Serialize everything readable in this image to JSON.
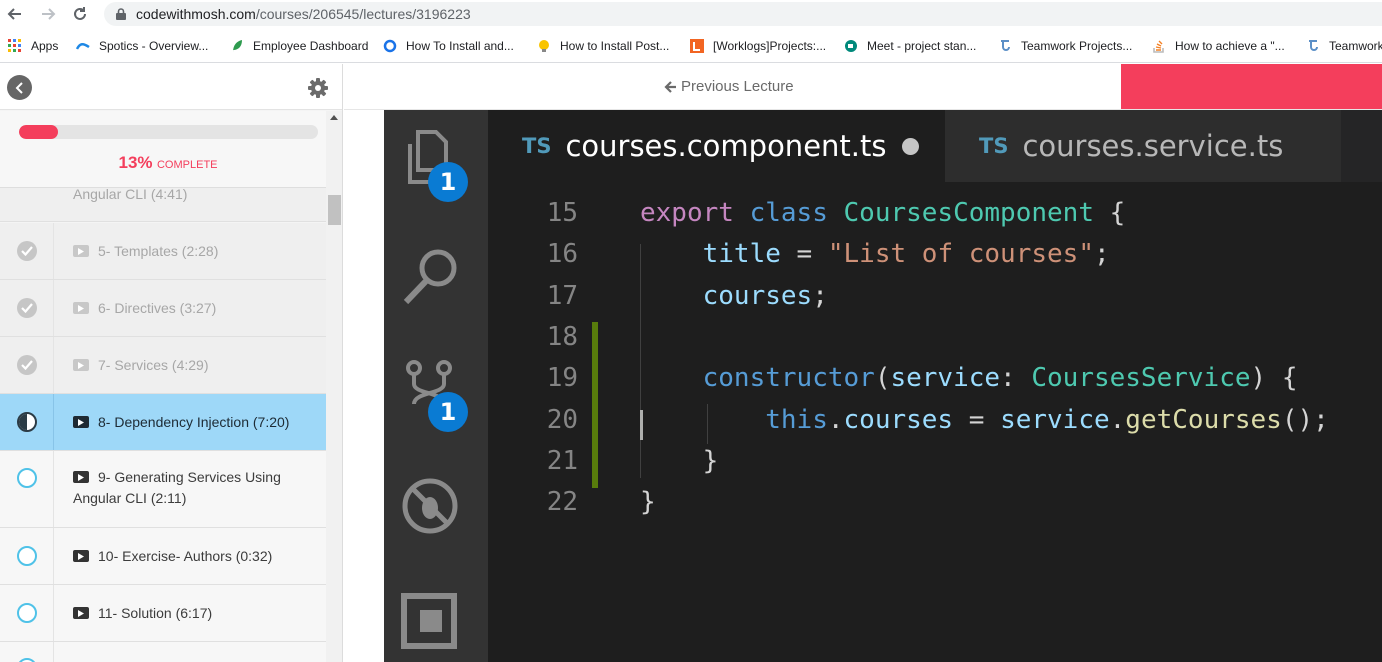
{
  "browser": {
    "url_host": "codewithmosh.com",
    "url_path": "/courses/206545/lectures/3196223"
  },
  "bookmarks": [
    {
      "label": "Apps",
      "icon": "apps-grid-icon"
    },
    {
      "label": "Spotics - Overview...",
      "icon": "spotics-icon"
    },
    {
      "label": "Employee Dashboard",
      "icon": "leaf-icon"
    },
    {
      "label": "How To Install and...",
      "icon": "refresh-blue-icon"
    },
    {
      "label": "How to Install Post...",
      "icon": "lightbulb-icon"
    },
    {
      "label": "[Worklogs]Projects:...",
      "icon": "worklogs-icon"
    },
    {
      "label": "Meet - project stan...",
      "icon": "meet-icon"
    },
    {
      "label": "Teamwork Projects...",
      "icon": "teamwork-icon"
    },
    {
      "label": "How to achieve a \"...",
      "icon": "stackoverflow-icon"
    },
    {
      "label": "Teamwork",
      "icon": "teamwork-icon"
    }
  ],
  "sidebar": {
    "progress_fraction": 0.13,
    "progress_percent": "13%",
    "progress_word": "COMPLETE",
    "ghost_title": "Angular CLI (4:41)",
    "lectures": [
      {
        "title": "5- Templates (2:28)",
        "state": "done"
      },
      {
        "title": "6- Directives (3:27)",
        "state": "done"
      },
      {
        "title": "7- Services (4:29)",
        "state": "done"
      },
      {
        "title": "8- Dependency Injection (7:20)",
        "state": "current"
      },
      {
        "title": "9- Generating Services Using Angular CLI (2:11)",
        "state": "todo"
      },
      {
        "title": "10- Exercise- Authors (0:32)",
        "state": "todo"
      },
      {
        "title": "11- Solution (6:17)",
        "state": "todo"
      }
    ]
  },
  "header": {
    "prev_label": "Previous Lecture"
  },
  "video": {
    "badge_explorer": "1",
    "badge_scm": "1",
    "tabs": [
      {
        "lang": "TS",
        "name": "courses.component.ts",
        "modified": true
      },
      {
        "lang": "TS",
        "name": "courses.service.ts",
        "modified": false
      }
    ],
    "line_numbers": [
      "15",
      "16",
      "17",
      "18",
      "19",
      "20",
      "21",
      "22"
    ],
    "code_tokens": {
      "l15_kw": "export",
      "l15_kw2": "class",
      "l15_cls": "CoursesComponent",
      "l15_tail": " {",
      "l16_prop": "title",
      "l16_op": " = ",
      "l16_str": "\"List of courses\"",
      "l16_tail": ";",
      "l17_prop": "courses",
      "l17_tail": ";",
      "l19_kw2": "constructor",
      "l19_p1": "(",
      "l19_prop": "service",
      "l19_colon": ": ",
      "l19_cls": "CoursesService",
      "l19_tail": ") {",
      "l20_kw2": "this",
      "l20_dot": ".",
      "l20_prop": "courses",
      "l20_op": " = ",
      "l20_prop2": "service",
      "l20_dot2": ".",
      "l20_fn": "getCourses",
      "l20_tail": "();",
      "l21": "}",
      "l22": "}"
    }
  },
  "colors": {
    "accent": "#f43e5c",
    "current_lecture_bg": "#9ed8f8",
    "todo_ring": "#4fc2e8"
  }
}
